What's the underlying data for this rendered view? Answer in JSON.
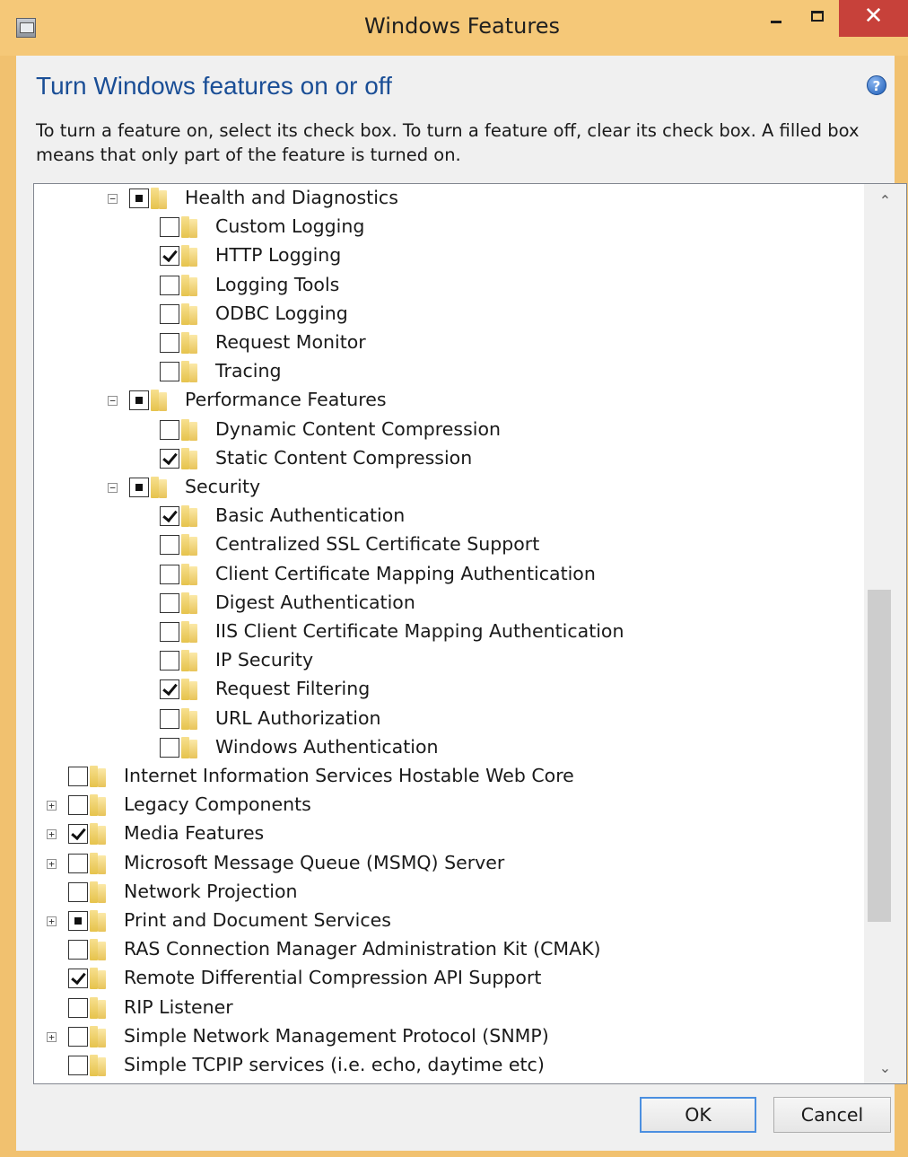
{
  "window": {
    "title": "Windows Features",
    "close_glyph": "✕"
  },
  "heading": "Turn Windows features on or off",
  "help_glyph": "?",
  "description": "To turn a feature on, select its check box. To turn a feature off, clear its check box. A filled box means that only part of the feature is turned on.",
  "features": [
    {
      "label": "Health and Diagnostics",
      "level": 2,
      "state": "partial",
      "expander": "minus"
    },
    {
      "label": "Custom Logging",
      "level": 3,
      "state": "unchecked",
      "expander": ""
    },
    {
      "label": "HTTP Logging",
      "level": 3,
      "state": "checked",
      "expander": ""
    },
    {
      "label": "Logging Tools",
      "level": 3,
      "state": "unchecked",
      "expander": ""
    },
    {
      "label": "ODBC Logging",
      "level": 3,
      "state": "unchecked",
      "expander": ""
    },
    {
      "label": "Request Monitor",
      "level": 3,
      "state": "unchecked",
      "expander": ""
    },
    {
      "label": "Tracing",
      "level": 3,
      "state": "unchecked",
      "expander": ""
    },
    {
      "label": "Performance Features",
      "level": 2,
      "state": "partial",
      "expander": "minus"
    },
    {
      "label": "Dynamic Content Compression",
      "level": 3,
      "state": "unchecked",
      "expander": ""
    },
    {
      "label": "Static Content Compression",
      "level": 3,
      "state": "checked",
      "expander": ""
    },
    {
      "label": "Security",
      "level": 2,
      "state": "partial",
      "expander": "minus"
    },
    {
      "label": "Basic Authentication",
      "level": 3,
      "state": "checked",
      "expander": ""
    },
    {
      "label": "Centralized SSL Certificate Support",
      "level": 3,
      "state": "unchecked",
      "expander": ""
    },
    {
      "label": "Client Certificate Mapping Authentication",
      "level": 3,
      "state": "unchecked",
      "expander": ""
    },
    {
      "label": "Digest Authentication",
      "level": 3,
      "state": "unchecked",
      "expander": ""
    },
    {
      "label": "IIS Client Certificate Mapping Authentication",
      "level": 3,
      "state": "unchecked",
      "expander": ""
    },
    {
      "label": "IP Security",
      "level": 3,
      "state": "unchecked",
      "expander": ""
    },
    {
      "label": "Request Filtering",
      "level": 3,
      "state": "checked",
      "expander": ""
    },
    {
      "label": "URL Authorization",
      "level": 3,
      "state": "unchecked",
      "expander": ""
    },
    {
      "label": "Windows Authentication",
      "level": 3,
      "state": "unchecked",
      "expander": ""
    },
    {
      "label": "Internet Information Services Hostable Web Core",
      "level": 0,
      "state": "unchecked",
      "expander": ""
    },
    {
      "label": "Legacy Components",
      "level": 0,
      "state": "unchecked",
      "expander": "plus"
    },
    {
      "label": "Media Features",
      "level": 0,
      "state": "checked",
      "expander": "plus"
    },
    {
      "label": "Microsoft Message Queue (MSMQ) Server",
      "level": 0,
      "state": "unchecked",
      "expander": "plus"
    },
    {
      "label": "Network Projection",
      "level": 0,
      "state": "unchecked",
      "expander": ""
    },
    {
      "label": "Print and Document Services",
      "level": 0,
      "state": "partial",
      "expander": "plus"
    },
    {
      "label": "RAS Connection Manager Administration Kit (CMAK)",
      "level": 0,
      "state": "unchecked",
      "expander": ""
    },
    {
      "label": "Remote Differential Compression API Support",
      "level": 0,
      "state": "checked",
      "expander": ""
    },
    {
      "label": "RIP Listener",
      "level": 0,
      "state": "unchecked",
      "expander": ""
    },
    {
      "label": "Simple Network Management Protocol (SNMP)",
      "level": 0,
      "state": "unchecked",
      "expander": "plus"
    },
    {
      "label": "Simple TCPIP services (i.e. echo, daytime etc)",
      "level": 0,
      "state": "unchecked",
      "expander": ""
    }
  ],
  "buttons": {
    "ok": "OK",
    "cancel": "Cancel"
  },
  "colors": {
    "titlebar": "#f5c878",
    "close": "#c7413a",
    "heading": "#1a4e96"
  }
}
